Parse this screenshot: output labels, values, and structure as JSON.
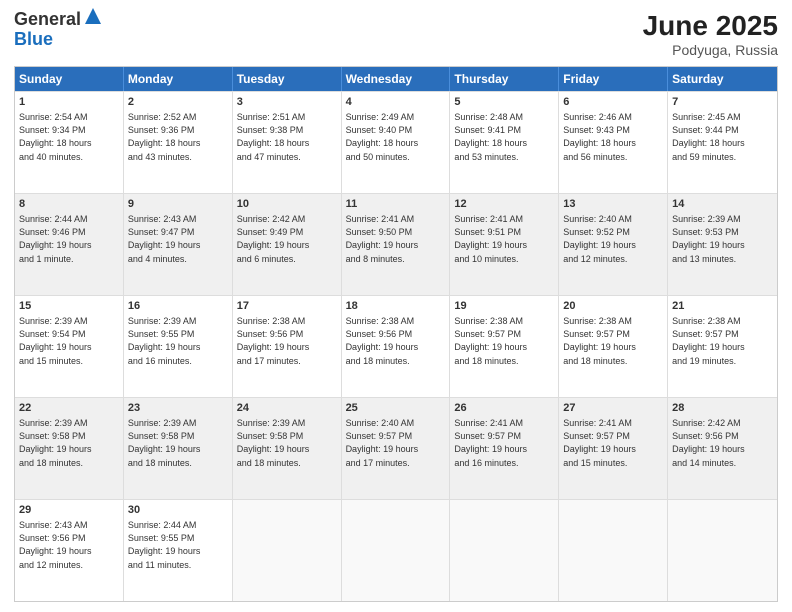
{
  "logo": {
    "general": "General",
    "blue": "Blue"
  },
  "title": {
    "month": "June 2025",
    "location": "Podyuga, Russia"
  },
  "header_days": [
    "Sunday",
    "Monday",
    "Tuesday",
    "Wednesday",
    "Thursday",
    "Friday",
    "Saturday"
  ],
  "rows": [
    [
      {
        "day": "1",
        "lines": [
          "Sunrise: 2:54 AM",
          "Sunset: 9:34 PM",
          "Daylight: 18 hours",
          "and 40 minutes."
        ],
        "shade": false
      },
      {
        "day": "2",
        "lines": [
          "Sunrise: 2:52 AM",
          "Sunset: 9:36 PM",
          "Daylight: 18 hours",
          "and 43 minutes."
        ],
        "shade": false
      },
      {
        "day": "3",
        "lines": [
          "Sunrise: 2:51 AM",
          "Sunset: 9:38 PM",
          "Daylight: 18 hours",
          "and 47 minutes."
        ],
        "shade": false
      },
      {
        "day": "4",
        "lines": [
          "Sunrise: 2:49 AM",
          "Sunset: 9:40 PM",
          "Daylight: 18 hours",
          "and 50 minutes."
        ],
        "shade": false
      },
      {
        "day": "5",
        "lines": [
          "Sunrise: 2:48 AM",
          "Sunset: 9:41 PM",
          "Daylight: 18 hours",
          "and 53 minutes."
        ],
        "shade": false
      },
      {
        "day": "6",
        "lines": [
          "Sunrise: 2:46 AM",
          "Sunset: 9:43 PM",
          "Daylight: 18 hours",
          "and 56 minutes."
        ],
        "shade": false
      },
      {
        "day": "7",
        "lines": [
          "Sunrise: 2:45 AM",
          "Sunset: 9:44 PM",
          "Daylight: 18 hours",
          "and 59 minutes."
        ],
        "shade": false
      }
    ],
    [
      {
        "day": "8",
        "lines": [
          "Sunrise: 2:44 AM",
          "Sunset: 9:46 PM",
          "Daylight: 19 hours",
          "and 1 minute."
        ],
        "shade": true
      },
      {
        "day": "9",
        "lines": [
          "Sunrise: 2:43 AM",
          "Sunset: 9:47 PM",
          "Daylight: 19 hours",
          "and 4 minutes."
        ],
        "shade": true
      },
      {
        "day": "10",
        "lines": [
          "Sunrise: 2:42 AM",
          "Sunset: 9:49 PM",
          "Daylight: 19 hours",
          "and 6 minutes."
        ],
        "shade": true
      },
      {
        "day": "11",
        "lines": [
          "Sunrise: 2:41 AM",
          "Sunset: 9:50 PM",
          "Daylight: 19 hours",
          "and 8 minutes."
        ],
        "shade": true
      },
      {
        "day": "12",
        "lines": [
          "Sunrise: 2:41 AM",
          "Sunset: 9:51 PM",
          "Daylight: 19 hours",
          "and 10 minutes."
        ],
        "shade": true
      },
      {
        "day": "13",
        "lines": [
          "Sunrise: 2:40 AM",
          "Sunset: 9:52 PM",
          "Daylight: 19 hours",
          "and 12 minutes."
        ],
        "shade": true
      },
      {
        "day": "14",
        "lines": [
          "Sunrise: 2:39 AM",
          "Sunset: 9:53 PM",
          "Daylight: 19 hours",
          "and 13 minutes."
        ],
        "shade": true
      }
    ],
    [
      {
        "day": "15",
        "lines": [
          "Sunrise: 2:39 AM",
          "Sunset: 9:54 PM",
          "Daylight: 19 hours",
          "and 15 minutes."
        ],
        "shade": false
      },
      {
        "day": "16",
        "lines": [
          "Sunrise: 2:39 AM",
          "Sunset: 9:55 PM",
          "Daylight: 19 hours",
          "and 16 minutes."
        ],
        "shade": false
      },
      {
        "day": "17",
        "lines": [
          "Sunrise: 2:38 AM",
          "Sunset: 9:56 PM",
          "Daylight: 19 hours",
          "and 17 minutes."
        ],
        "shade": false
      },
      {
        "day": "18",
        "lines": [
          "Sunrise: 2:38 AM",
          "Sunset: 9:56 PM",
          "Daylight: 19 hours",
          "and 18 minutes."
        ],
        "shade": false
      },
      {
        "day": "19",
        "lines": [
          "Sunrise: 2:38 AM",
          "Sunset: 9:57 PM",
          "Daylight: 19 hours",
          "and 18 minutes."
        ],
        "shade": false
      },
      {
        "day": "20",
        "lines": [
          "Sunrise: 2:38 AM",
          "Sunset: 9:57 PM",
          "Daylight: 19 hours",
          "and 18 minutes."
        ],
        "shade": false
      },
      {
        "day": "21",
        "lines": [
          "Sunrise: 2:38 AM",
          "Sunset: 9:57 PM",
          "Daylight: 19 hours",
          "and 19 minutes."
        ],
        "shade": false
      }
    ],
    [
      {
        "day": "22",
        "lines": [
          "Sunrise: 2:39 AM",
          "Sunset: 9:58 PM",
          "Daylight: 19 hours",
          "and 18 minutes."
        ],
        "shade": true
      },
      {
        "day": "23",
        "lines": [
          "Sunrise: 2:39 AM",
          "Sunset: 9:58 PM",
          "Daylight: 19 hours",
          "and 18 minutes."
        ],
        "shade": true
      },
      {
        "day": "24",
        "lines": [
          "Sunrise: 2:39 AM",
          "Sunset: 9:58 PM",
          "Daylight: 19 hours",
          "and 18 minutes."
        ],
        "shade": true
      },
      {
        "day": "25",
        "lines": [
          "Sunrise: 2:40 AM",
          "Sunset: 9:57 PM",
          "Daylight: 19 hours",
          "and 17 minutes."
        ],
        "shade": true
      },
      {
        "day": "26",
        "lines": [
          "Sunrise: 2:41 AM",
          "Sunset: 9:57 PM",
          "Daylight: 19 hours",
          "and 16 minutes."
        ],
        "shade": true
      },
      {
        "day": "27",
        "lines": [
          "Sunrise: 2:41 AM",
          "Sunset: 9:57 PM",
          "Daylight: 19 hours",
          "and 15 minutes."
        ],
        "shade": true
      },
      {
        "day": "28",
        "lines": [
          "Sunrise: 2:42 AM",
          "Sunset: 9:56 PM",
          "Daylight: 19 hours",
          "and 14 minutes."
        ],
        "shade": true
      }
    ],
    [
      {
        "day": "29",
        "lines": [
          "Sunrise: 2:43 AM",
          "Sunset: 9:56 PM",
          "Daylight: 19 hours",
          "and 12 minutes."
        ],
        "shade": false
      },
      {
        "day": "30",
        "lines": [
          "Sunrise: 2:44 AM",
          "Sunset: 9:55 PM",
          "Daylight: 19 hours",
          "and 11 minutes."
        ],
        "shade": false
      },
      {
        "day": "",
        "lines": [],
        "shade": true,
        "empty": true
      },
      {
        "day": "",
        "lines": [],
        "shade": true,
        "empty": true
      },
      {
        "day": "",
        "lines": [],
        "shade": true,
        "empty": true
      },
      {
        "day": "",
        "lines": [],
        "shade": true,
        "empty": true
      },
      {
        "day": "",
        "lines": [],
        "shade": true,
        "empty": true
      }
    ]
  ]
}
